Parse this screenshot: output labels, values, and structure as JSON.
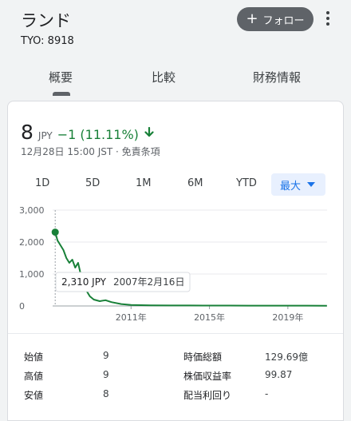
{
  "company": {
    "name": "ランド",
    "ticker": "TYO: 8918"
  },
  "follow_label": "フォロー",
  "tabs": [
    {
      "label": "概要",
      "selected": true
    },
    {
      "label": "比較",
      "selected": false
    },
    {
      "label": "財務情報",
      "selected": false
    }
  ],
  "quote": {
    "price": "8",
    "currency": "JPY",
    "change": "−1 (11.11%)",
    "timestamp": "12月28日 15:00 JST · 免責条項"
  },
  "ranges": [
    "1D",
    "5D",
    "1M",
    "6M",
    "YTD",
    "最大"
  ],
  "selected_range": "最大",
  "tooltip": {
    "value": "2,310 JPY",
    "date": "2007年2月16日"
  },
  "colors": {
    "accent": "#1a73e8",
    "down": "#188038"
  },
  "chart_data": {
    "type": "line",
    "ylim": [
      0,
      3000
    ],
    "y_ticks": [
      "3,000",
      "2,000",
      "1,000",
      "0"
    ],
    "x_ticks": [
      "2011年",
      "2015年",
      "2019年"
    ],
    "series": [
      {
        "x": [
          2007.13,
          2007.25,
          2007.4,
          2007.55,
          2007.7,
          2007.85,
          2008.0,
          2008.15,
          2008.3,
          2008.5,
          2008.7,
          2008.9,
          2009.1,
          2009.4,
          2009.7,
          2010.0,
          2010.5,
          2011.0,
          2012.0,
          2013.0,
          2014.0,
          2015.0,
          2016.0,
          2017.0,
          2018.0,
          2019.0,
          2020.0,
          2020.99
        ],
        "y": [
          2310,
          2050,
          1900,
          1750,
          1500,
          1350,
          1450,
          1200,
          1350,
          800,
          500,
          300,
          200,
          150,
          180,
          120,
          60,
          30,
          20,
          15,
          14,
          12,
          12,
          11,
          10,
          10,
          9,
          8
        ]
      }
    ]
  },
  "stats": [
    {
      "label": "始値",
      "value": "9"
    },
    {
      "label": "高値",
      "value": "9"
    },
    {
      "label": "安値",
      "value": "8"
    },
    {
      "label": "時価総額",
      "value": "129.69億"
    },
    {
      "label": "株価収益率",
      "value": "99.87"
    },
    {
      "label": "配当利回り",
      "value": "-"
    }
  ]
}
